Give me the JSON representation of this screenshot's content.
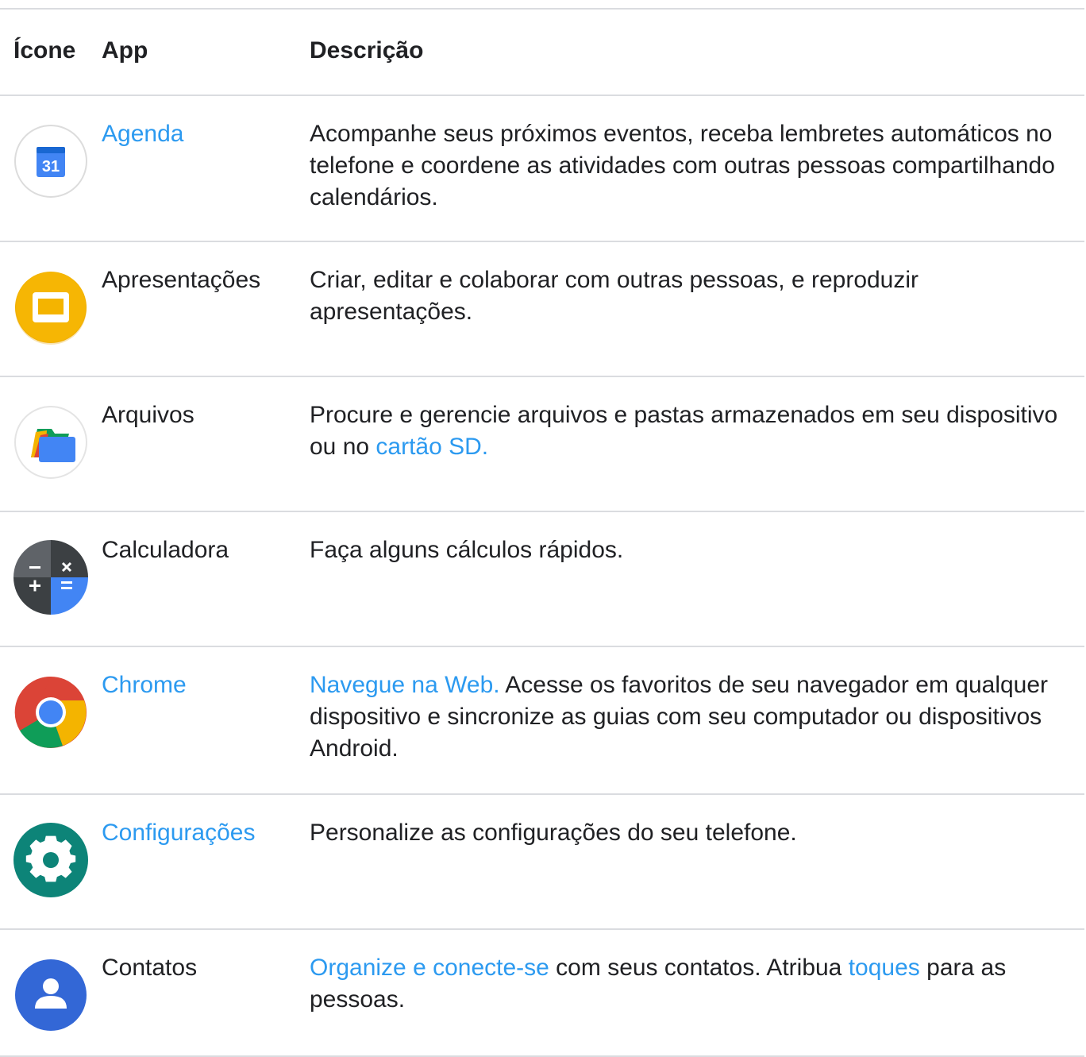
{
  "header": {
    "col_icon": "Ícone",
    "col_app": "App",
    "col_desc": "Descrição"
  },
  "rows": [
    {
      "icon": "calendar-icon",
      "app": "Agenda",
      "app_is_link": true,
      "desc": [
        {
          "text": "Acompanhe seus próximos eventos, receba lembretes automáticos no telefone e coordene as atividades com outras pessoas compartilhando calendários.",
          "link": false
        }
      ],
      "icon_text": "31"
    },
    {
      "icon": "slides-icon",
      "app": "Apresentações",
      "app_is_link": false,
      "desc": [
        {
          "text": "Criar, editar e colaborar com outras pessoas, e reproduzir apresentações.",
          "link": false
        }
      ]
    },
    {
      "icon": "files-icon",
      "app": "Arquivos",
      "app_is_link": false,
      "desc": [
        {
          "text": "Procure e gerencie arquivos e pastas armazenados em seu dispositivo ou no ",
          "link": false
        },
        {
          "text": "cartão SD.",
          "link": true
        }
      ]
    },
    {
      "icon": "calculator-icon",
      "app": "Calculadora",
      "app_is_link": false,
      "desc": [
        {
          "text": "Faça alguns cálculos rápidos.",
          "link": false
        }
      ]
    },
    {
      "icon": "chrome-icon",
      "app": "Chrome",
      "app_is_link": true,
      "desc": [
        {
          "text": "Navegue na Web.",
          "link": true
        },
        {
          "text": " Acesse os favoritos de seu navegador em qualquer dispositivo e sincronize as guias com seu computador ou dispositivos Android.",
          "link": false
        }
      ]
    },
    {
      "icon": "settings-icon",
      "app": "Configurações",
      "app_is_link": true,
      "desc": [
        {
          "text": "Personalize as configurações do seu telefone.",
          "link": false
        }
      ]
    },
    {
      "icon": "contacts-icon",
      "app": "Contatos",
      "app_is_link": false,
      "desc": [
        {
          "text": "Organize e conecte-se",
          "link": true
        },
        {
          "text": " com seus contatos. Atribua ",
          "link": false
        },
        {
          "text": "toques",
          "link": true
        },
        {
          "text": " para as pessoas.",
          "link": false
        }
      ]
    }
  ],
  "colors": {
    "link": "#2c9af0",
    "text": "#202124",
    "divider": "#dadce0"
  }
}
